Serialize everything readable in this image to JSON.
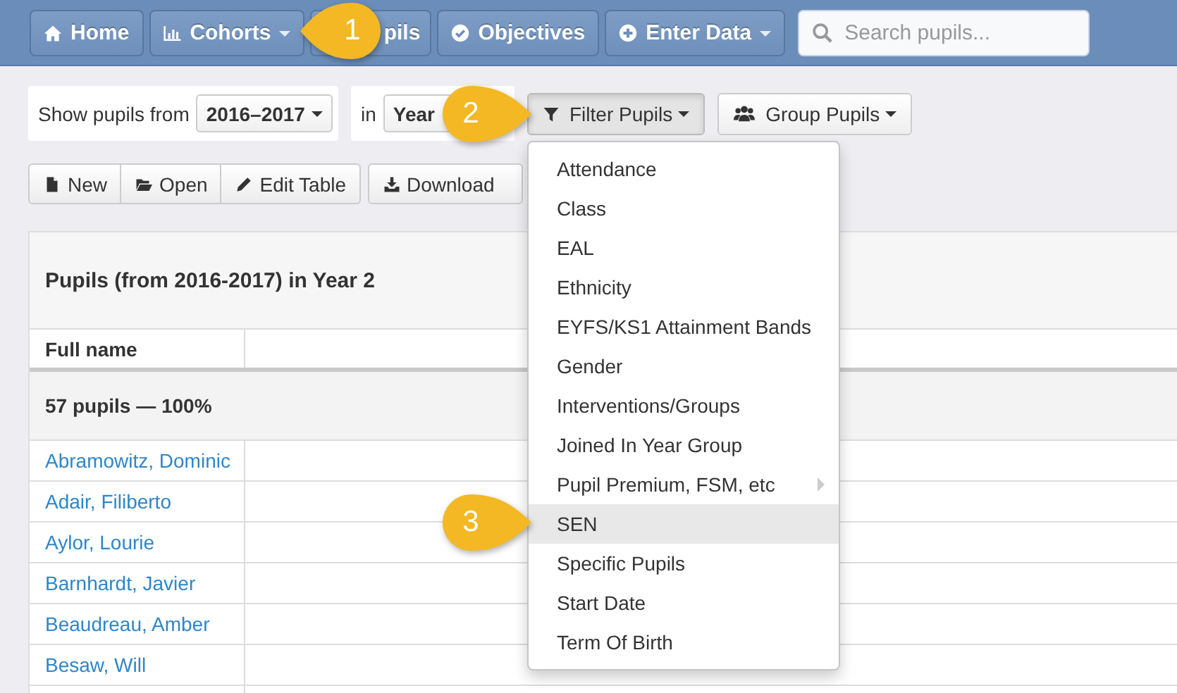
{
  "navbar": {
    "buttons": [
      {
        "label": "Home",
        "dropdown": false
      },
      {
        "label": "Cohorts",
        "dropdown": true
      },
      {
        "label": "pils",
        "dropdown": false
      },
      {
        "label": "Objectives",
        "dropdown": false
      },
      {
        "label": "Enter Data",
        "dropdown": true
      }
    ],
    "search": {
      "placeholder": "Search pupils..."
    }
  },
  "filters": {
    "from_label": "Show pupils from",
    "from_value": "2016–2017",
    "in_label": "in",
    "in_value": "Year",
    "buttons": [
      {
        "label": "Filter Pupils",
        "pressed": true
      },
      {
        "label": "Group Pupils",
        "pressed": false
      }
    ]
  },
  "actions": {
    "group": [
      "New",
      "Open",
      "Edit Table"
    ],
    "download": "Download"
  },
  "table": {
    "title": "Pupils (from 2016-2017) in Year 2",
    "columns": [
      "Full name"
    ],
    "group_row": "57 pupils — 100%",
    "rows": [
      "Abramowitz, Dominic",
      "Adair, Filiberto",
      "Aylor, Lourie",
      "Barnhardt, Javier",
      "Beaudreau, Amber",
      "Besaw, Will"
    ]
  },
  "filter_menu": {
    "items": [
      {
        "label": "Attendance",
        "selected": false,
        "has_submenu": false
      },
      {
        "label": "Class",
        "selected": false,
        "has_submenu": false
      },
      {
        "label": "EAL",
        "selected": false,
        "has_submenu": false
      },
      {
        "label": "Ethnicity",
        "selected": false,
        "has_submenu": false
      },
      {
        "label": "EYFS/KS1 Attainment Bands",
        "selected": false,
        "has_submenu": false
      },
      {
        "label": "Gender",
        "selected": false,
        "has_submenu": false
      },
      {
        "label": "Interventions/Groups",
        "selected": false,
        "has_submenu": false
      },
      {
        "label": "Joined In Year Group",
        "selected": false,
        "has_submenu": false
      },
      {
        "label": "Pupil Premium, FSM, etc",
        "selected": false,
        "has_submenu": true
      },
      {
        "label": "SEN",
        "selected": true,
        "has_submenu": false
      },
      {
        "label": "Specific Pupils",
        "selected": false,
        "has_submenu": false
      },
      {
        "label": "Start Date",
        "selected": false,
        "has_submenu": false
      },
      {
        "label": "Term Of Birth",
        "selected": false,
        "has_submenu": false
      }
    ]
  },
  "callouts": [
    {
      "number": "1"
    },
    {
      "number": "2"
    },
    {
      "number": "3"
    }
  ]
}
